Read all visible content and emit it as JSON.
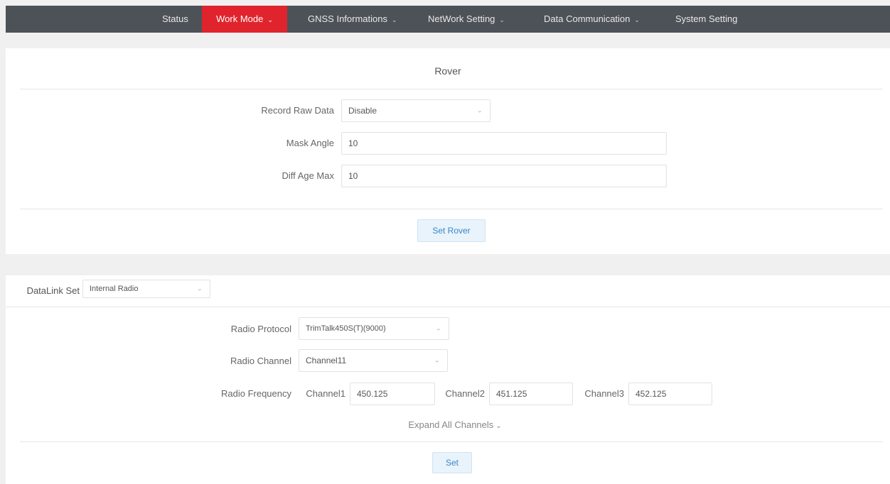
{
  "nav": {
    "items": [
      {
        "label": "Status"
      },
      {
        "label": "Work Mode"
      },
      {
        "label": "GNSS Informations"
      },
      {
        "label": "NetWork Setting"
      },
      {
        "label": "Data Communication"
      },
      {
        "label": "System Setting"
      }
    ],
    "active": "Work Mode",
    "caret": "⌄",
    "active_color": "#e0242d",
    "bar_color": "#4d5258"
  },
  "rover": {
    "title": "Rover",
    "record_raw_data": {
      "label": "Record Raw Data",
      "value": "Disable"
    },
    "mask_angle": {
      "label": "Mask Angle",
      "value": "10"
    },
    "diff_age_max": {
      "label": "Diff Age Max",
      "value": "10"
    },
    "set_button": "Set Rover"
  },
  "datalink": {
    "label": "DataLink Set",
    "value": "Internal Radio",
    "radio_protocol": {
      "label": "Radio Protocol",
      "value": "TrimTalk450S(T)(9000)"
    },
    "radio_channel": {
      "label": "Radio Channel",
      "value": "Channel11"
    },
    "radio_frequency": {
      "label": "Radio Frequency",
      "channels": [
        {
          "label": "Channel1",
          "value": "450.125"
        },
        {
          "label": "Channel2",
          "value": "451.125"
        },
        {
          "label": "Channel3",
          "value": "452.125"
        }
      ]
    },
    "expand_link": "Expand All Channels",
    "set_button": "Set"
  },
  "icons": {
    "dropdown": "chevron-down-icon"
  }
}
